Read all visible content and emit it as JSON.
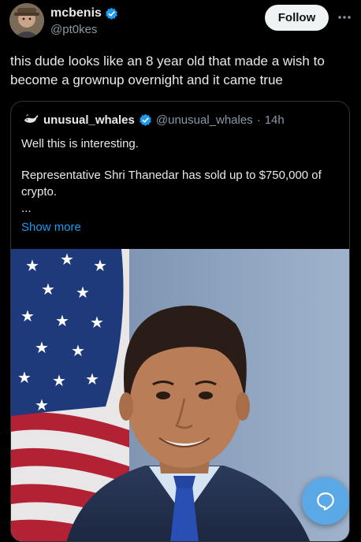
{
  "post": {
    "author_name": "mcbenis",
    "author_handle": "@pt0kes",
    "follow_label": "Follow",
    "text": "this dude looks like an 8 year old that made a wish to become a grownup overnight and it came true",
    "avatar_icon": "profile-photo-icon",
    "verified_icon": "verified-badge-icon",
    "more_icon": "more-options-icon"
  },
  "quote": {
    "author_name": "unusual_whales",
    "author_handle": "@unusual_whales",
    "separator": "·",
    "time": "14h",
    "line1": "Well this is interesting.",
    "line2": "Representative Shri Thanedar has sold up to $750,000 of crypto.",
    "ellipsis": "...",
    "show_more": "Show more",
    "avatar_icon": "whale-logo-icon",
    "image_alt": "portrait photo with american flag"
  },
  "fab": {
    "icon": "reply-bubble-icon"
  },
  "colors": {
    "background": "#000000",
    "text": "#e7e9ea",
    "muted": "#8b98a5",
    "link": "#1d9bf0",
    "verified": "#1d9bf0",
    "border": "#2f3336",
    "fab": "#5aa9e6"
  }
}
